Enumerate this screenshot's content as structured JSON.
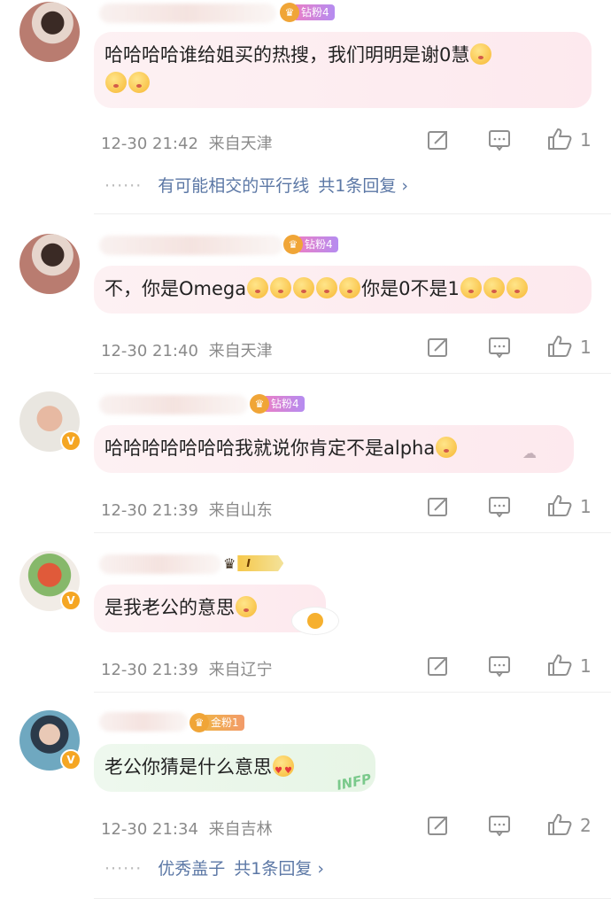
{
  "comments": [
    {
      "fan_badge": "钻粉4",
      "text": "哈哈哈哈谁给姐买的热搜，我们明明是谢0慧",
      "time": "12-30 21:42",
      "location": "来自天津",
      "likes": "1",
      "replies": {
        "first_reply": "有可能相交的平行线",
        "count_label": "共1条回复 ›"
      }
    },
    {
      "fan_badge": "钻粉4",
      "text_a": "不，你是Omega",
      "text_b": "你是0不是1",
      "time": "12-30 21:40",
      "location": "来自天津",
      "likes": "1"
    },
    {
      "fan_badge": "钻粉4",
      "text": "哈哈哈哈哈哈哈我就说你肯定不是alpha",
      "time": "12-30 21:39",
      "location": "来自山东",
      "likes": "1"
    },
    {
      "vip_badge": "I",
      "text": "是我老公的意思",
      "time": "12-30 21:39",
      "location": "来自辽宁",
      "likes": "1"
    },
    {
      "fan_badge": "金粉1",
      "text": "老公你猜是什么意思",
      "bubble_deco": "INFP",
      "time": "12-30 21:34",
      "location": "来自吉林",
      "likes": "2",
      "replies": {
        "first_reply": "优秀盖子",
        "count_label": "共1条回复 ›"
      }
    }
  ],
  "colors": {
    "link": "#5b77a5",
    "meta": "#8a8a8a",
    "bubble_pink": "#fdf1f3",
    "bubble_green": "#eef8ee"
  },
  "icons": [
    "repost-icon",
    "comment-icon",
    "like-icon",
    "crown-icon",
    "emoji-icon",
    "verified-badge-icon"
  ]
}
